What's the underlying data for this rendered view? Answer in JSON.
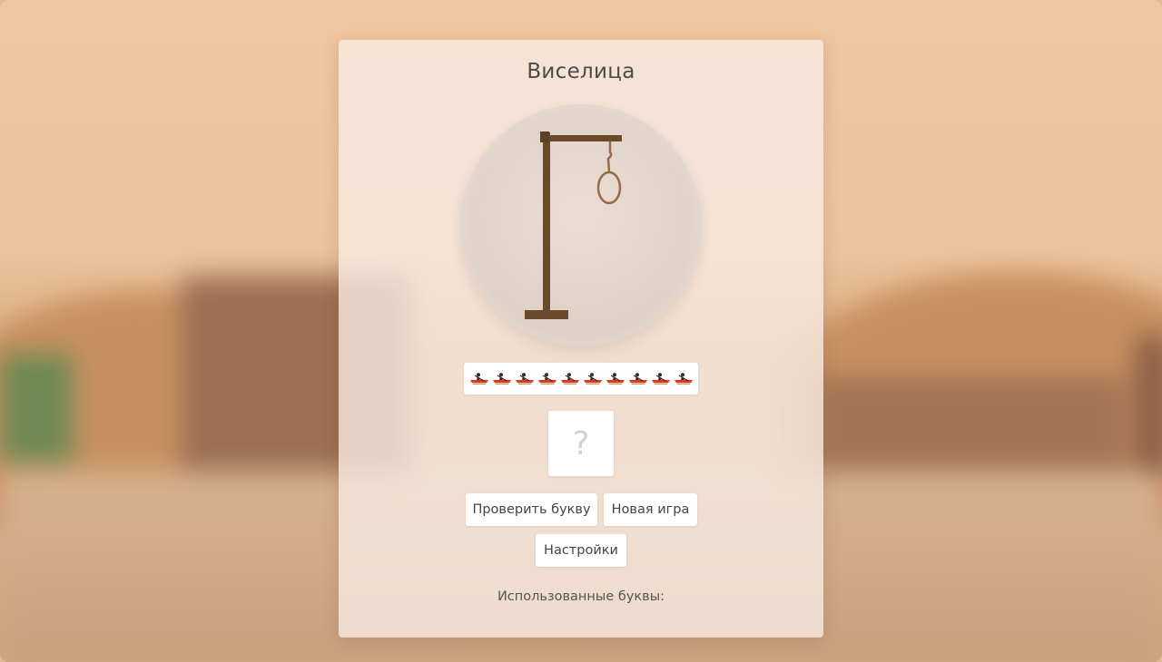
{
  "game": {
    "title": "Виселица",
    "word_slots": 10,
    "slot_icon": "boat-icon",
    "letter_input": {
      "value": "",
      "placeholder": "?"
    },
    "buttons": {
      "check_letter": "Проверить букву",
      "new_game": "Новая игра",
      "settings": "Настройки"
    },
    "used_letters_label": "Использованные буквы:",
    "used_letters": ""
  },
  "colors": {
    "gallows": "#6b4a2b",
    "rope": "#9a6a44",
    "boat": "#d83b25"
  }
}
